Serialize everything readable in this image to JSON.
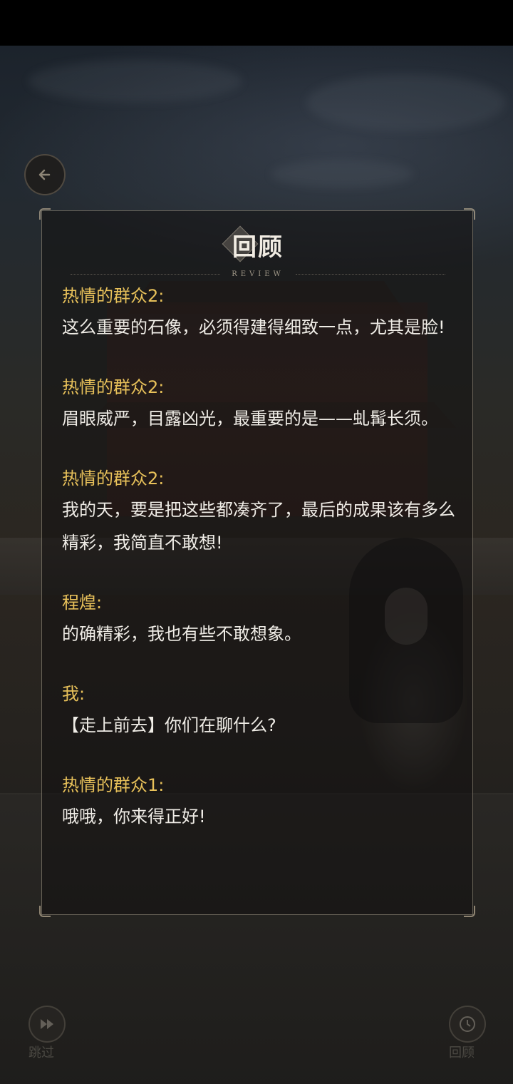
{
  "nav": {
    "back_icon": "back-arrow-icon"
  },
  "review": {
    "title": "回顾",
    "subtitle": "REVIEW",
    "entries": [
      {
        "speaker": "热情的群众2:",
        "text": "这么重要的石像，必须得建得细致一点，尤其是脸!"
      },
      {
        "speaker": "热情的群众2:",
        "text": "眉眼威严，目露凶光，最重要的是——虬髯长须。"
      },
      {
        "speaker": "热情的群众2:",
        "text": "我的天，要是把这些都凑齐了，最后的成果该有多么精彩，我简直不敢想!"
      },
      {
        "speaker": "程煌:",
        "text": "的确精彩，我也有些不敢想象。"
      },
      {
        "speaker": "我:",
        "text": "【走上前去】你们在聊什么?"
      },
      {
        "speaker": "热情的群众1:",
        "text": "哦哦，你来得正好!"
      }
    ]
  },
  "bottom": {
    "left_icon": "fast-forward-icon",
    "right_icon": "clock-icon",
    "left_label": "跳过",
    "right_label": "回顾"
  },
  "colors": {
    "speaker": "#e8c15a",
    "text": "#efece6",
    "panel_border": "#aaa08c"
  }
}
